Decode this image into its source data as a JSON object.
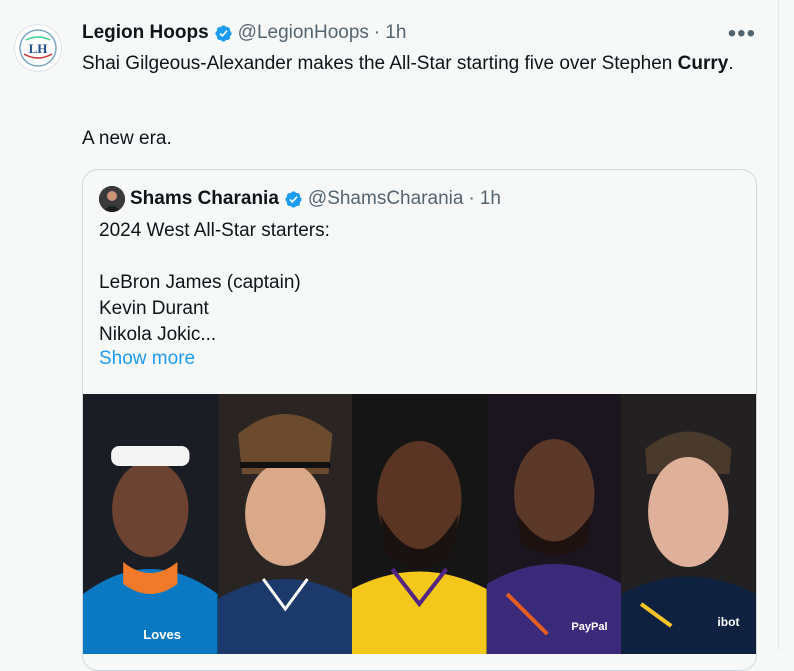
{
  "tweet": {
    "author_name": "Legion Hoops",
    "handle": "@LegionHoops",
    "separator": "·",
    "time": "1h",
    "more_label": "•••",
    "avatar_logo_text": "LH",
    "text_prefix": "Shai Gilgeous-Alexander makes the All-Star starting five over Stephen ",
    "text_bold": "Curry",
    "text_suffix": ".",
    "line2": "A new era."
  },
  "quote": {
    "author_name": "Shams Charania",
    "handle": "@ShamsCharania",
    "separator": "·",
    "time": "1h",
    "lines": [
      "2024 West All-Star starters:",
      "",
      "LeBron James (captain)",
      "Kevin Durant",
      "Nikola Jokic..."
    ],
    "show_more": "Show more",
    "image_players": [
      {
        "jersey_color": "#0a78c2",
        "skin": "#6b4330",
        "jersey_text": "Loves"
      },
      {
        "jersey_color": "#1b3a6b",
        "skin": "#d9a98a",
        "jersey_text": ""
      },
      {
        "jersey_color": "#f3c81b",
        "skin": "#5a3523",
        "jersey_text": ""
      },
      {
        "jersey_color": "#3b2a7a",
        "skin": "#5b3828",
        "jersey_text": "PayPal"
      },
      {
        "jersey_color": "#0e2240",
        "skin": "#e0b19a",
        "jersey_text": "ibotta"
      }
    ]
  },
  "colors": {
    "background": "#f7f9f9",
    "text": "#0f1419",
    "muted": "#536471",
    "link": "#1d9bf0",
    "verified": "#1d9bf0",
    "border": "#cfd9de"
  },
  "icons": {
    "avatar": "legion-hoops-logo",
    "verified": "verified-badge-icon",
    "more": "more-options-icon"
  }
}
